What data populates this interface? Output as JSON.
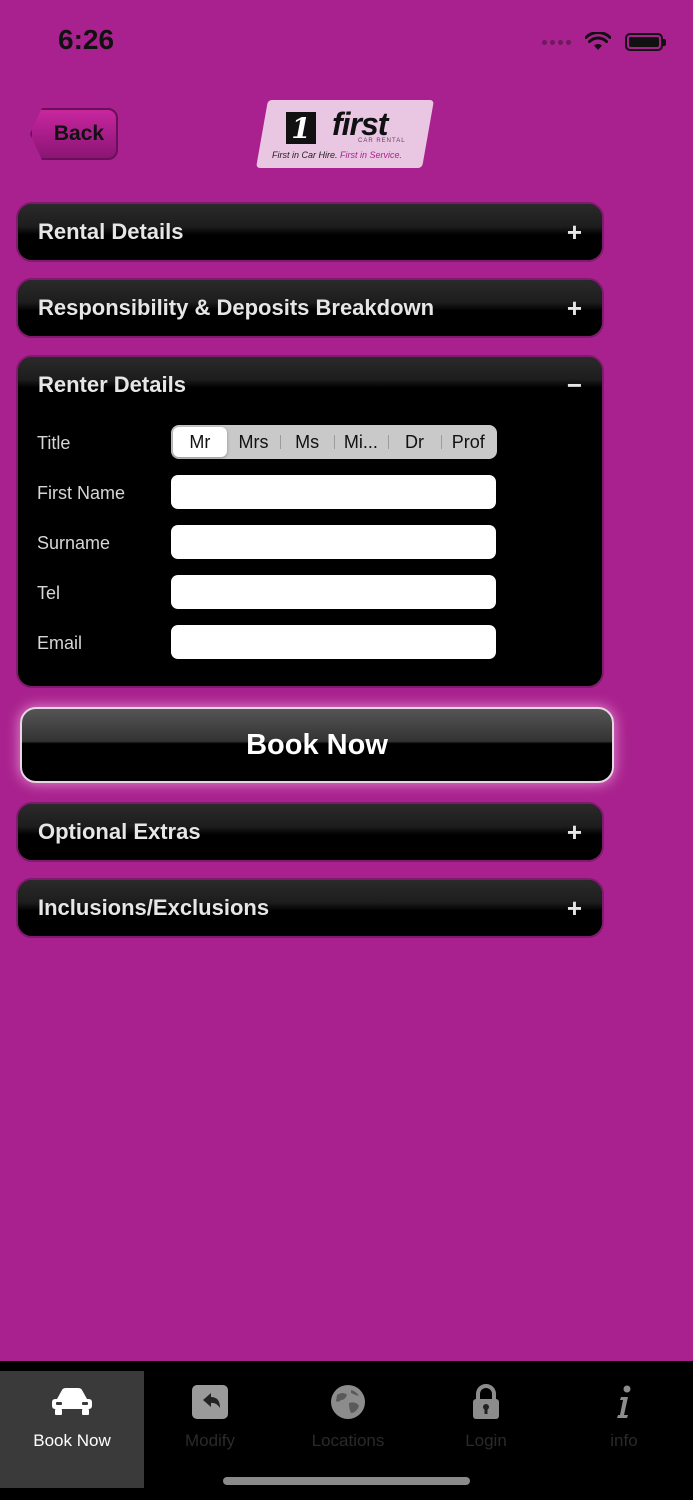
{
  "status_bar": {
    "time": "6:26"
  },
  "header": {
    "back_label": "Back"
  },
  "logo": {
    "numeral": "1",
    "word": "first",
    "sub": "CAR RENTAL",
    "tagline_a": "First in Car Hire.",
    "tagline_b": "First in Service."
  },
  "sections": {
    "rental": {
      "title": "Rental Details",
      "toggle": "+"
    },
    "responsibility": {
      "title": "Responsibility & Deposits Breakdown",
      "toggle": "+"
    },
    "renter": {
      "title": "Renter Details",
      "toggle": "−"
    },
    "optional": {
      "title": "Optional Extras",
      "toggle": "+"
    },
    "inclusions": {
      "title": "Inclusions/Exclusions",
      "toggle": "+"
    }
  },
  "form": {
    "title_label": "Title",
    "title_options": [
      "Mr",
      "Mrs",
      "Ms",
      "Mi...",
      "Dr",
      "Prof"
    ],
    "title_selected": "Mr",
    "first_name_label": "First Name",
    "first_name_value": "",
    "surname_label": "Surname",
    "surname_value": "",
    "tel_label": "Tel",
    "tel_value": "",
    "email_label": "Email",
    "email_value": ""
  },
  "book_button": "Book Now",
  "tabbar": {
    "tabs": [
      {
        "label": "Book Now",
        "icon": "car-icon",
        "active": true
      },
      {
        "label": "Modify",
        "icon": "undo-icon",
        "active": false
      },
      {
        "label": "Locations",
        "icon": "globe-icon",
        "active": false
      },
      {
        "label": "Login",
        "icon": "lock-icon",
        "active": false
      },
      {
        "label": "info",
        "icon": "info-icon",
        "active": false
      }
    ]
  },
  "colors": {
    "background": "#a9218e",
    "panel": "#000000",
    "accent_pink": "#c8269f"
  }
}
